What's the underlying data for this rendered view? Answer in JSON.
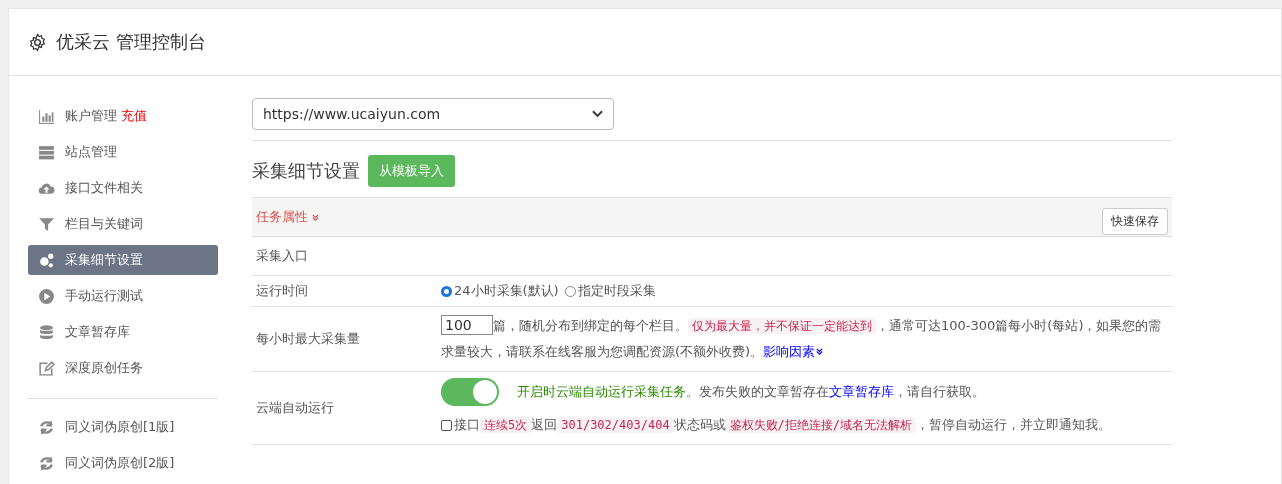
{
  "header": {
    "title": "优采云 管理控制台"
  },
  "sidebar": {
    "groups": [
      [
        {
          "label": "账户管理",
          "badge": "充值",
          "kind": "chart",
          "selected": false
        },
        {
          "label": "站点管理",
          "kind": "server",
          "selected": false
        },
        {
          "label": "接口文件相关",
          "kind": "cloud",
          "selected": false
        },
        {
          "label": "栏目与关键词",
          "kind": "filter",
          "selected": false
        },
        {
          "label": "采集细节设置",
          "kind": "gears",
          "selected": true
        },
        {
          "label": "手动运行测试",
          "kind": "play",
          "selected": false
        },
        {
          "label": "文章暂存库",
          "kind": "database",
          "selected": false
        },
        {
          "label": "深度原创任务",
          "kind": "edit",
          "selected": false
        }
      ],
      [
        {
          "label": "同义词伪原创[1版]",
          "kind": "refresh",
          "selected": false
        },
        {
          "label": "同义词伪原创[2版]",
          "kind": "refresh",
          "selected": false
        }
      ]
    ]
  },
  "site_select": {
    "value": "https://www.ucaiyun.com"
  },
  "section": {
    "title": "采集细节设置",
    "import_button": "从模板导入"
  },
  "panel": {
    "heading": "任务属性",
    "save_button": "快速保存",
    "rows": [
      {
        "kind": "blank",
        "label": "采集入口"
      },
      {
        "kind": "radio",
        "label": "运行时间",
        "options": [
          {
            "label": "24小时采集(默认)",
            "selected": true
          },
          {
            "label": "指定时段采集",
            "selected": false
          }
        ]
      },
      {
        "kind": "number",
        "label": "每小时最大采集量",
        "value": "100",
        "segments": [
          {
            "kind": "text",
            "text": "篇，随机分布到绑定的每个栏目。"
          },
          {
            "kind": "code",
            "text": "仅为最大量，并不保证一定能达到"
          },
          {
            "kind": "text",
            "text": "，通常可达100-300篇每小时(每站)，如果您的需求量较大，请联系在线客服为您调配资源(不额外收费)。"
          },
          {
            "kind": "link",
            "text": "影响因素"
          }
        ]
      },
      {
        "kind": "toggle",
        "label": "云端自动运行",
        "on": true,
        "segments": [
          {
            "kind": "green",
            "text": "开启时云端自动运行采集任务。"
          },
          {
            "kind": "text",
            "text": "发布失败的文章暂存在"
          },
          {
            "kind": "link",
            "text": "文章暂存库"
          },
          {
            "kind": "text",
            "text": "，请自行获取。"
          }
        ],
        "check": {
          "checked": false,
          "segments": [
            {
              "kind": "text",
              "text": "接口"
            },
            {
              "kind": "code",
              "text": "连续5次"
            },
            {
              "kind": "text",
              "text": "返回"
            },
            {
              "kind": "code",
              "text": "301/302/403/404"
            },
            {
              "kind": "text",
              "text": "状态码或"
            },
            {
              "kind": "code",
              "text": "鉴权失败/拒绝连接/域名无法解析"
            },
            {
              "kind": "text",
              "text": "，暂停自动运行，并立即通知我。"
            }
          ]
        }
      }
    ]
  }
}
